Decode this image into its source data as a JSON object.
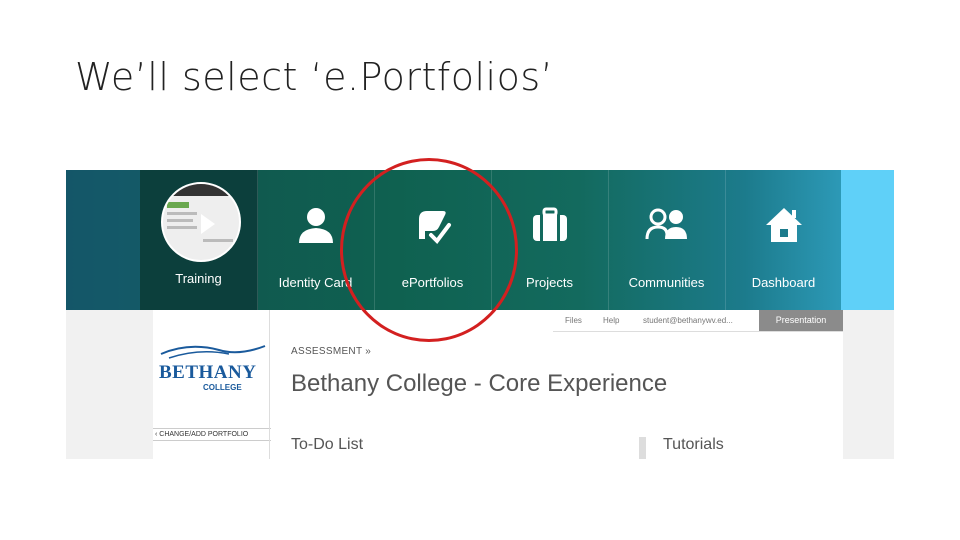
{
  "slide": {
    "title": "We’ll select ‘e.Portfolios’"
  },
  "nav": {
    "tabs": [
      {
        "label": "Training",
        "icon": "play-video-icon"
      },
      {
        "label": "Identity Card",
        "icon": "person-icon"
      },
      {
        "label": "ePortfolios",
        "icon": "portfolio-icon"
      },
      {
        "label": "Projects",
        "icon": "briefcase-icon"
      },
      {
        "label": "Communities",
        "icon": "group-icon"
      },
      {
        "label": "Dashboard",
        "icon": "home-icon"
      }
    ]
  },
  "topbar": {
    "files": "Files",
    "help": "Help",
    "user": "student@bethanywv.ed...",
    "presentation": "Presentation"
  },
  "sidebar": {
    "logo_word": "BETHANY",
    "logo_college": "COLLEGE",
    "change_link": "‹ CHANGE/ADD PORTFOLIO"
  },
  "main": {
    "breadcrumb": "ASSESSMENT  »",
    "title": "Bethany College - Core Experience",
    "todo_heading": "To-Do List",
    "tutorials_heading": "Tutorials"
  },
  "colors": {
    "highlight": "#d32020",
    "nav_gradient_start": "#0f4b56",
    "nav_gradient_end": "#58c8f0"
  }
}
